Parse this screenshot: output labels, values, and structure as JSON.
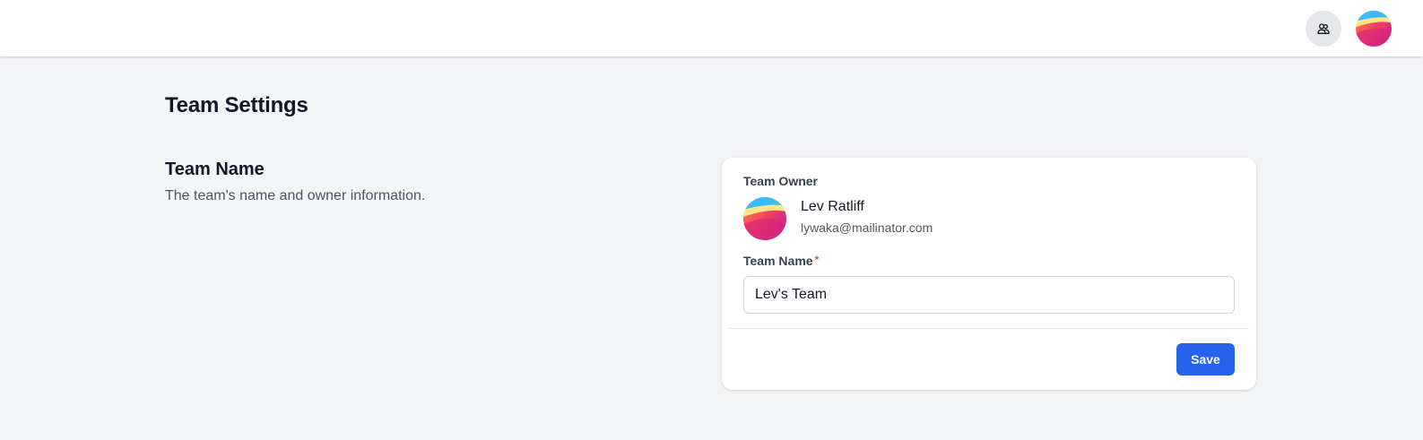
{
  "header": {
    "team_switcher_icon": "users-icon",
    "user_avatar_icon": "avatar-gradient"
  },
  "page": {
    "title": "Team Settings"
  },
  "section": {
    "title": "Team Name",
    "description": "The team's name and owner information."
  },
  "owner": {
    "label": "Team Owner",
    "name": "Lev Ratliff",
    "email": "lywaka@mailinator.com"
  },
  "form": {
    "team_name_label": "Team Name",
    "required_marker": "*",
    "team_name_value": "Lev's Team",
    "save_label": "Save"
  },
  "colors": {
    "accent": "#2563eb",
    "background": "#f3f4f6",
    "required": "#ef4444"
  }
}
